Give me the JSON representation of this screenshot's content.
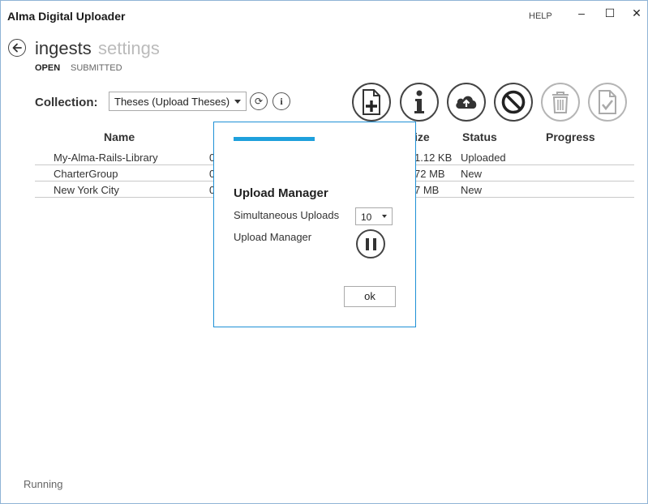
{
  "app": {
    "title": "Alma Digital Uploader",
    "help_label": "HELP",
    "window_controls": {
      "minimize": "–",
      "maximize": "☐",
      "close": "✕"
    }
  },
  "nav": {
    "primary": [
      "ingests",
      "settings"
    ],
    "active_primary": "ingests",
    "subtabs": [
      "OPEN",
      "SUBMITTED"
    ],
    "active_subtab": "OPEN"
  },
  "collection": {
    "label": "Collection:",
    "selected": "Theses (Upload Theses)",
    "refresh_icon": "refresh-icon",
    "info_icon": "info-icon",
    "info_glyph": "i",
    "refresh_glyph": "⟳"
  },
  "toolbar": {
    "buttons": [
      {
        "name": "new-ingest",
        "icon": "add-file-icon",
        "enabled": true
      },
      {
        "name": "info",
        "icon": "info-icon",
        "enabled": true
      },
      {
        "name": "upload",
        "icon": "cloud-upload-icon",
        "enabled": true
      },
      {
        "name": "cancel",
        "icon": "cancel-icon",
        "enabled": true
      },
      {
        "name": "delete",
        "icon": "trash-icon",
        "enabled": false
      },
      {
        "name": "submit",
        "icon": "submit-file-icon",
        "enabled": false
      }
    ]
  },
  "table": {
    "columns": [
      "Name",
      "ize",
      "Status",
      "Progress"
    ],
    "rows": [
      {
        "name": "My-Alma-Rails-Library",
        "date_fragment": "0",
        "size_fragment": "1.12 KB",
        "status": "Uploaded",
        "progress": ""
      },
      {
        "name": "CharterGroup",
        "date_fragment": "0",
        "size_fragment": "72 MB",
        "status": "New",
        "progress": ""
      },
      {
        "name": "New York City",
        "date_fragment": "0",
        "size_fragment": "7 MB",
        "status": "New",
        "progress": ""
      }
    ]
  },
  "modal": {
    "title": "Upload Manager",
    "simultaneous_label": "Simultaneous Uploads",
    "simultaneous_value": "10",
    "manager_label": "Upload Manager",
    "pause_icon": "pause-icon",
    "ok_label": "ok",
    "accent_color": "#1ea0dc"
  },
  "status_bar": {
    "text": "Running"
  }
}
